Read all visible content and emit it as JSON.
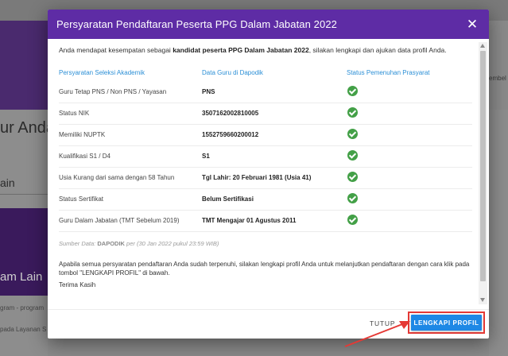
{
  "background": {
    "title_fragment": "ur Anda",
    "label_fragment": "ain",
    "card_fragment": "am Lain",
    "small_line1": "gram - program",
    "small_line2": "pada Layanan S",
    "right_fragment": "embel"
  },
  "modal": {
    "title": "Persyaratan Pendaftaran Peserta PPG Dalam Jabatan 2022",
    "close_icon": "close-icon",
    "intro_prefix": "Anda mendapat kesempatan sebagai ",
    "intro_bold": "kandidat peserta PPG Dalam Jabatan 2022",
    "intro_suffix": ", silakan lengkapi dan ajukan data profil Anda.",
    "table": {
      "headers": [
        "Persyaratan Seleksi Akademik",
        "Data Guru di Dapodik",
        "Status Pemenuhan Prasyarat"
      ],
      "rows": [
        {
          "requirement": "Guru Tetap PNS / Non PNS / Yayasan",
          "value": "PNS",
          "status_icon": "check-circle-icon"
        },
        {
          "requirement": "Status NIK",
          "value": "3507162002810005",
          "status_icon": "check-circle-icon"
        },
        {
          "requirement": "Memiliki NUPTK",
          "value": "1552759660200012",
          "status_icon": "check-circle-icon"
        },
        {
          "requirement": "Kualifikasi S1 / D4",
          "value": "S1",
          "status_icon": "check-circle-icon"
        },
        {
          "requirement": "Usia Kurang dari sama dengan 58 Tahun",
          "value": "Tgl Lahir: 20 Februari 1981 (Usia 41)",
          "status_icon": "check-circle-icon"
        },
        {
          "requirement": "Status Sertifikat",
          "value": "Belum Sertifikasi",
          "status_icon": "check-circle-icon"
        },
        {
          "requirement": "Guru Dalam Jabatan (TMT Sebelum 2019)",
          "value": "TMT Mengajar 01 Agustus 2011",
          "status_icon": "check-circle-icon"
        }
      ]
    },
    "source_prefix": "Sumber Data: ",
    "source_bold": "DAPODIK",
    "source_suffix": " per (30 Jan 2022 pukul 23:59 WIB)",
    "note": "Apabila semua persyaratan pendaftaran Anda sudah terpenuhi, silakan lengkapi profil Anda untuk melanjutkan pendaftaran dengan cara klik pada tombol \"LENGKAPI PROFIL\" di bawah.",
    "thanks": "Terima Kasih",
    "footer": {
      "tutup_label": "TUTUP",
      "lengkapi_label": "LENGKAPI PROFIL"
    }
  },
  "colors": {
    "header": "#5e2ca5",
    "primary_button": "#1e88e5",
    "highlight_border": "#e53935",
    "check": "#43a047",
    "column_header": "#2b8fd6"
  }
}
